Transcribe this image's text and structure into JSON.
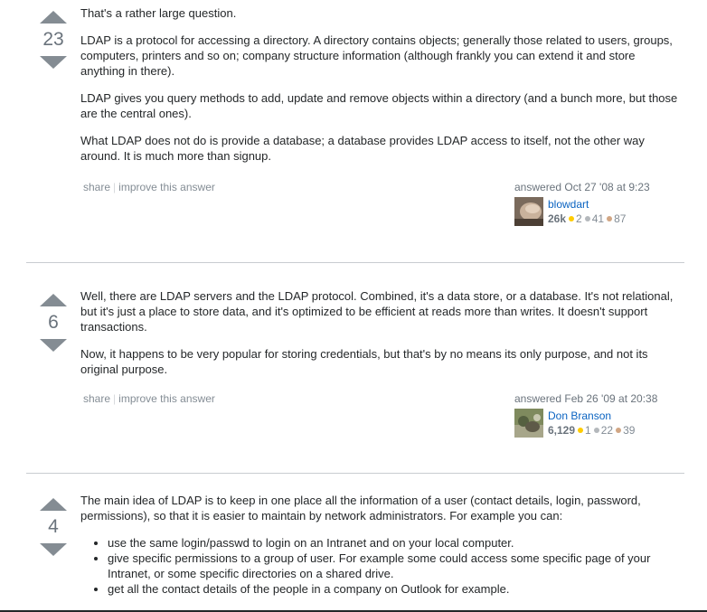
{
  "answers": [
    {
      "votes": "23",
      "paragraphs": [
        "That's a rather large question.",
        "LDAP is a protocol for accessing a directory. A directory contains objects; generally those related to users, groups, computers, printers and so on; company structure information (although frankly you can extend it and store anything in there).",
        "LDAP gives you query methods to add, update and remove objects within a directory (and a bunch more, but those are the central ones).",
        "What LDAP does not do is provide a database; a database provides LDAP access to itself, not the other way around. It is much more than signup."
      ],
      "share_label": "share",
      "improve_label": "improve this answer",
      "action_time": "answered Oct 27 '08 at 9:23",
      "user_name": "blowdart",
      "reputation": "26k",
      "gold": "2",
      "silver": "41",
      "bronze": "87"
    },
    {
      "votes": "6",
      "paragraphs": [
        "Well, there are LDAP servers and the LDAP protocol. Combined, it's a data store, or a database. It's not relational, but it's just a place to store data, and it's optimized to be efficient at reads more than writes. It doesn't support transactions.",
        "Now, it happens to be very popular for storing credentials, but that's by no means its only purpose, and not its original purpose."
      ],
      "share_label": "share",
      "improve_label": "improve this answer",
      "action_time": "answered Feb 26 '09 at 20:38",
      "user_name": "Don Branson",
      "reputation": "6,129",
      "gold": "1",
      "silver": "22",
      "bronze": "39"
    },
    {
      "votes": "4",
      "paragraphs": [
        "The main idea of LDAP is to keep in one place all the information of a user (contact details, login, password, permissions), so that it is easier to maintain by network administrators. For example you can:"
      ],
      "list": [
        "use the same login/passwd to login on an Intranet and on your local computer.",
        "give specific permissions to a group of user. For example some could access some specific page of your Intranet, or some specific directories on a shared drive.",
        "get all the contact details of the people in a company on Outlook for example."
      ]
    }
  ],
  "icons": {
    "upvote": "arrow-up-icon",
    "downvote": "arrow-down-icon",
    "gold_badge": "gold-badge-icon",
    "silver_badge": "silver-badge-icon",
    "bronze_badge": "bronze-badge-icon"
  },
  "colors": {
    "link": "#0a63c1",
    "vote_arrow": "#848c93",
    "gold": "#ffcc01",
    "silver": "#b4b8bc",
    "bronze": "#d1a684"
  }
}
